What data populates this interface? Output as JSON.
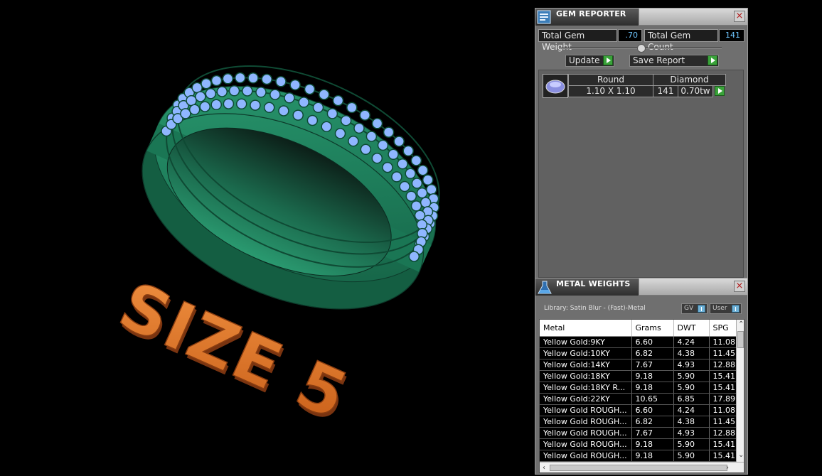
{
  "viewport": {
    "text_overlay": "SIZE 5",
    "ring_color": "#1f8a63",
    "stone_color": "#8fb6ff",
    "text_color": "#e07830"
  },
  "gem_reporter": {
    "title": "GEM REPORTER",
    "close": "×",
    "total_weight_label": "Total Gem Weight",
    "total_weight_value": ".70",
    "total_count_label": "Total Gem Count",
    "total_count_value": "141",
    "update_label": "Update",
    "save_label": "Save Report",
    "gems": [
      {
        "shape": "Round",
        "material": "Diamond",
        "size": "1.10 X 1.10",
        "count": "141",
        "weight": "0.70tw"
      }
    ]
  },
  "metal_weights": {
    "title": "METAL WEIGHTS",
    "close": "×",
    "library": "Library: Satin Blur - (Fast)-Metal",
    "toggle_gv": "GV",
    "toggle_user": "User",
    "columns": [
      "Metal",
      "Grams",
      "DWT",
      "SPG"
    ],
    "rows": [
      [
        "Yellow Gold:9KY",
        "6.60",
        "4.24",
        "11.08"
      ],
      [
        "Yellow Gold:10KY",
        "6.82",
        "4.38",
        "11.45"
      ],
      [
        "Yellow Gold:14KY",
        "7.67",
        "4.93",
        "12.88"
      ],
      [
        "Yellow Gold:18KY",
        "9.18",
        "5.90",
        "15.41"
      ],
      [
        "Yellow Gold:18KY R...",
        "9.18",
        "5.90",
        "15.41"
      ],
      [
        "Yellow Gold:22KY",
        "10.65",
        "6.85",
        "17.89"
      ],
      [
        "Yellow Gold ROUGH...",
        "6.60",
        "4.24",
        "11.08"
      ],
      [
        "Yellow Gold ROUGH...",
        "6.82",
        "4.38",
        "11.45"
      ],
      [
        "Yellow Gold ROUGH...",
        "7.67",
        "4.93",
        "12.88"
      ],
      [
        "Yellow Gold ROUGH...",
        "9.18",
        "5.90",
        "15.41"
      ],
      [
        "Yellow Gold ROUGH...",
        "9.18",
        "5.90",
        "15.41"
      ]
    ]
  }
}
